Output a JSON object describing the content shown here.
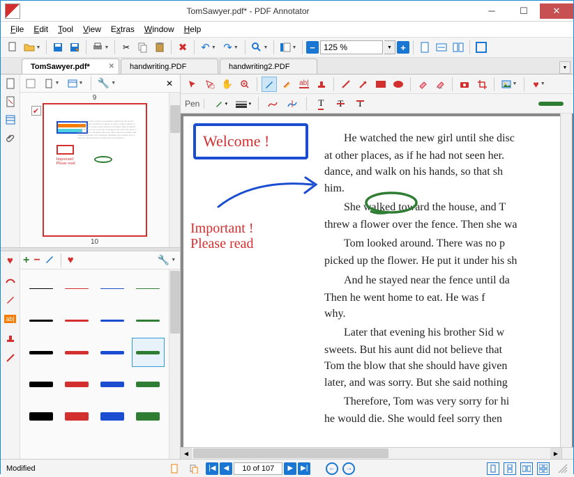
{
  "window": {
    "title": "TomSawyer.pdf* - PDF Annotator"
  },
  "menu": {
    "file": "File",
    "edit": "Edit",
    "tool": "Tool",
    "view": "View",
    "extras": "Extras",
    "window": "Window",
    "help": "Help"
  },
  "toolbar": {
    "zoom": "125 %"
  },
  "tabs": [
    {
      "label": "TomSawyer.pdf*",
      "active": true
    },
    {
      "label": "handwriting.PDF",
      "active": false
    },
    {
      "label": "handwriting2.PDF",
      "active": false
    }
  ],
  "sidepanel": {
    "page_above": "9",
    "page_below": "10"
  },
  "favorites": {
    "rows": [
      [
        {
          "c": "#000",
          "w": 1
        },
        {
          "c": "#d32f2f",
          "w": 1
        },
        {
          "c": "#1a4dcf",
          "w": 1
        },
        {
          "c": "#2e7d32",
          "w": 1
        }
      ],
      [
        {
          "c": "#000",
          "w": 3
        },
        {
          "c": "#d32f2f",
          "w": 3
        },
        {
          "c": "#1a4dcf",
          "w": 3
        },
        {
          "c": "#2e7d32",
          "w": 3
        }
      ],
      [
        {
          "c": "#000",
          "w": 5
        },
        {
          "c": "#d32f2f",
          "w": 5
        },
        {
          "c": "#1a4dcf",
          "w": 5
        },
        {
          "c": "#2e7d32",
          "w": 5,
          "sel": true
        }
      ],
      [
        {
          "c": "#000",
          "w": 8
        },
        {
          "c": "#d32f2f",
          "w": 8
        },
        {
          "c": "#1a4dcf",
          "w": 8
        },
        {
          "c": "#2e7d32",
          "w": 8
        }
      ],
      [
        {
          "c": "#000",
          "w": 12
        },
        {
          "c": "#d32f2f",
          "w": 12
        },
        {
          "c": "#1a4dcf",
          "w": 12
        },
        {
          "c": "#2e7d32",
          "w": 12
        }
      ]
    ]
  },
  "anntool": {
    "label": "Pen"
  },
  "annotations": {
    "welcome": "Welcome !",
    "note1": "Important !",
    "note2": "Please read"
  },
  "doc": {
    "p1": "He watched the new girl until she disc",
    "p1b": "at other places, as if he had not seen her.",
    "p2": "dance, and walk on his hands, so that sh",
    "p2b": "him.",
    "p3": "She walked toward the house, and T",
    "p3b": "threw a flower over the fence. Then she wa",
    "p4": "Tom looked around. There was no p",
    "p4b": "picked up the flower. He put it under his sh",
    "p5": "And he stayed near the fence until da",
    "p5b": "Then he went home to eat. He was f",
    "p5c": "why.",
    "p6": "Later that evening his brother Sid w",
    "p6b": "sweets. But his aunt did not believe that",
    "p6c": "Tom the blow that she should have given",
    "p6d": "later, and was sorry. But she said nothing",
    "p7": "Therefore, Tom was very sorry for hi",
    "p7b": "he would die. She would feel sorry then"
  },
  "status": {
    "modified": "Modified",
    "page": "10 of 107"
  }
}
